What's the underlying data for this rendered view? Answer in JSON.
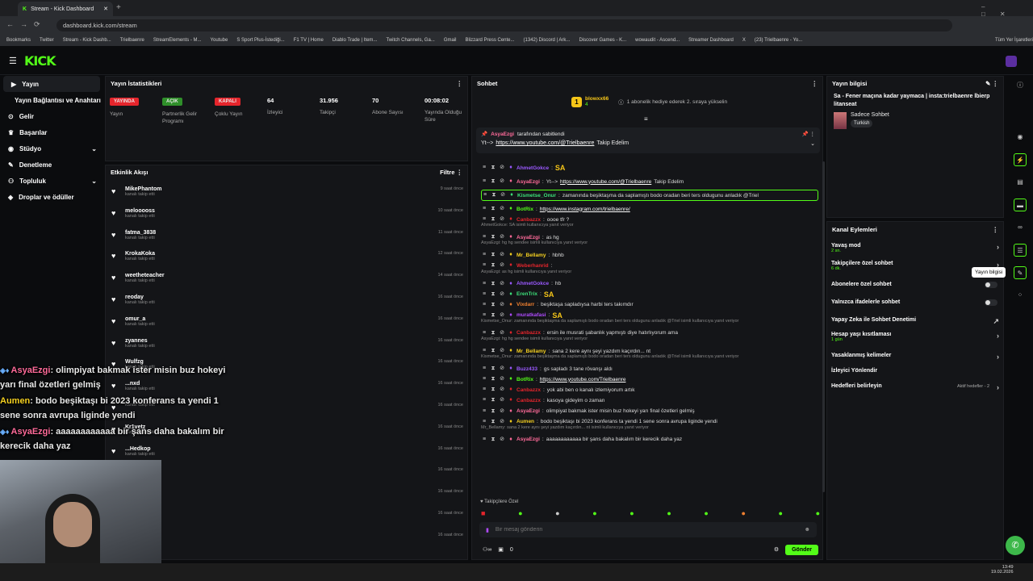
{
  "browser": {
    "tab_title": "Stream - Kick Dashboard",
    "url": "dashboard.kick.com/stream",
    "bookmarks": [
      "Bookmarks",
      "Twitter",
      "Stream - Kick Dashb...",
      "Trielbaenre",
      "StreamElements - M...",
      "Youtube",
      "S Sport Plus-İstediği...",
      "F1 TV | Home",
      "Diablo Trade | Item...",
      "Twitch Channels, Ga...",
      "Gmail",
      "Blizzard Press Cente...",
      "(1342) Discord | Ark...",
      "Discover Games - K...",
      "wowaudit - Ascend...",
      "Streamer Dashboard",
      "X",
      "(23) Trielbaenre - Yo...",
      "Tüm Yer İşaretleri"
    ]
  },
  "sidebar": {
    "items": [
      {
        "label": "Yayın"
      },
      {
        "label": "Yayın Bağlantısı ve Anahtarı"
      },
      {
        "label": "Gelir"
      },
      {
        "label": "Başarılar"
      },
      {
        "label": "Stüdyo"
      },
      {
        "label": "Denetleme"
      },
      {
        "label": "Topluluk"
      },
      {
        "label": "Droplar ve ödüller"
      }
    ]
  },
  "stats": {
    "title": "Yayın İstatistikleri",
    "items": [
      {
        "badge": "YAYINDA",
        "label": "Yayın",
        "color": "#e5252c"
      },
      {
        "badge": "AÇIK",
        "label": "Partnerlik Gelir Programı",
        "color": "#2f8f2a"
      },
      {
        "badge": "KAPALI",
        "label": "Çoklu Yayın",
        "color": "#e5252c"
      },
      {
        "value": "64",
        "label": "İzleyici"
      },
      {
        "value": "31.956",
        "label": "Takipçi"
      },
      {
        "value": "70",
        "label": "Abone Sayısı"
      },
      {
        "value": "00:08:02",
        "label": "Yayında Olduğu Süre"
      }
    ]
  },
  "activity": {
    "title": "Etkinlik Akışı",
    "filter": "Filtre",
    "action": "kanalı takip etti",
    "rows": [
      {
        "name": "MikePhantom",
        "time": "9 saat önce"
      },
      {
        "name": "melooooss",
        "time": "10 saat önce"
      },
      {
        "name": "fatma_3838",
        "time": "11 saat önce"
      },
      {
        "name": "KrokaKoka",
        "time": "12 saat önce"
      },
      {
        "name": "weetheteacher",
        "time": "14 saat önce"
      },
      {
        "name": "reoday",
        "time": "16 saat önce"
      },
      {
        "name": "omur_a",
        "time": "16 saat önce"
      },
      {
        "name": "zyannes",
        "time": "16 saat önce"
      },
      {
        "name": "Wulfzg",
        "time": "16 saat önce"
      },
      {
        "name": "...nxd",
        "time": "16 saat önce"
      },
      {
        "name": "",
        "time": "16 saat önce"
      },
      {
        "name": "Kr1vetz",
        "time": "16 saat önce"
      },
      {
        "name": "...Hedkop",
        "time": "16 saat önce"
      },
      {
        "name": "",
        "time": "16 saat önce"
      },
      {
        "name": "",
        "time": "16 saat önce"
      },
      {
        "name": "",
        "time": "16 saat önce"
      },
      {
        "name": "",
        "time": "16 saat önce"
      }
    ]
  },
  "chat": {
    "title": "Sohbet",
    "gift_user": "blowxx66",
    "gift_count": "4",
    "gift_text": "1 abonelik hediye ederek 2. sıraya yükselin",
    "pinned_by": "AsyaEzgi",
    "pinned_suffix": "tarafından sabitlendi",
    "pinned_text": "Yt-->",
    "pinned_link": "https://www.youtube.com/@Trielbaenre",
    "pinned_after": "Takip Edelim",
    "messages": [
      {
        "user": "AhmetGokce",
        "color": "#9b59ff",
        "text": "SA"
      },
      {
        "user": "AsyaEzgi",
        "color": "#ff6b9a",
        "text": "Yt-->",
        "link": "https://www.youtube.com/@Trielbaenre",
        "after": "Takip Edelim"
      },
      {
        "user": "Kismetse_Onur",
        "color": "#3de07a",
        "text": "zamanında beşiktaşma da saplamıştı bodo oradan beri ters oldugunu anladık @Triel"
      },
      {
        "user": "BotRix",
        "color": "#53fc18",
        "text": "",
        "link": "https://www.instagram.com/trielbaenre/"
      },
      {
        "user": "Canbazzx",
        "color": "#e5252c",
        "text": "oooe tfr ?"
      },
      {
        "reply": "AhmetGokce: SA isimli kullanıcıya yanıt veriyor"
      },
      {
        "user": "AsyaEzgi",
        "color": "#ff6b9a",
        "text": "as hg"
      },
      {
        "reply": "AsyaEzgi: hg hg sendee isimli kullanıcıya yanıt veriyor"
      },
      {
        "user": "Mr_Bellamy",
        "color": "#f5d020",
        "text": "hbhb"
      },
      {
        "user": "Weberhanrid",
        "color": "#e5252c",
        "text": ""
      },
      {
        "reply": "AsyaEzgi: as hg isimli kullanıcıya yanıt veriyor"
      },
      {
        "user": "AhmetGokce",
        "color": "#9b59ff",
        "text": "hb"
      },
      {
        "user": "ErenTrix",
        "color": "#3de07a",
        "text": "SA"
      },
      {
        "user": "Vixdarr",
        "color": "#f08030",
        "text": "beşiktaşa sapladıysa harbi ters takımdır"
      },
      {
        "user": "muratkafasi",
        "color": "#b04bff",
        "text": "SA"
      },
      {
        "reply": "Kismetse_Onur: zamanında beşiktaşma da saplamıştı bodo oradan beri ters oldugunu anladık @Triel isimli kullanıcıya yanıt veriyor"
      },
      {
        "user": "Canbazzx",
        "color": "#e5252c",
        "text": "ersin ile musrati şabanlık yapmıştı diye hatırlıyorum ama"
      },
      {
        "reply": "AsyaEzgi: hg hg sendee isimli kullanıcıya yanıt veriyor"
      },
      {
        "user": "Mr_Bellamy",
        "color": "#f5d020",
        "text": "sana 2 kere aynı şeyi yazdım kaçırdın... nt"
      },
      {
        "reply": "Kismetse_Onur: zamanında beşiktaşma da saplamıştı bodo oradan beri ters oldugunu anladık @Triel isimli kullanıcıya yanıt veriyor"
      },
      {
        "user": "Buzz433",
        "color": "#9b59ff",
        "text": "gs sapladı 3 tane rövanşı aldı"
      },
      {
        "user": "BotRix",
        "color": "#53fc18",
        "text": "",
        "link": "https://www.youtube.com/Trielbaenre"
      },
      {
        "user": "Canbazzx",
        "color": "#e5252c",
        "text": "yok abi ben o kanalı izlemiyorum artık"
      },
      {
        "user": "Canbazzx",
        "color": "#e5252c",
        "text": "kasoya gideyim o zaman"
      },
      {
        "user": "AsyaEzgi",
        "color": "#ff6b9a",
        "text": "olimpiyat bakmak ister misin buz hokeyi yarı final özetleri gelmiş"
      },
      {
        "user": "Aumen",
        "color": "#f5d020",
        "text": "bodo beşiktaşı bi 2023 konferans ta yendi 1 sene sonra avrupa liginde yendi"
      },
      {
        "reply": "Mr_Bellamy: sana 2 kere aynı şeyi yazdım kaçırdın... nt isimli kullanıcıya yanıt veriyor"
      },
      {
        "user": "AsyaEzgi",
        "color": "#ff6b9a",
        "text": "aaaaaaaaaaaa bir şans daha bakalım bir kerecik daha yaz"
      }
    ],
    "followers_only": "Takipçilere Özel",
    "input_placeholder": "Bir mesaj gönderin",
    "points": "0",
    "send_label": "Gönder"
  },
  "stream_info": {
    "title": "Yayın bilgisi",
    "stream_title": "Sa - Fener maçına kadar yaymaca | insta:trielbaenre lbierp litanseat",
    "category": "Sadece Sohbet",
    "tag": "Turkish"
  },
  "channel_actions": {
    "title": "Kanal Eylemleri",
    "tooltip": "Yayın bilgisi",
    "items": [
      {
        "label": "Yavaş mod",
        "sub": "2 sn."
      },
      {
        "label": "Takipçilere özel sohbet",
        "sub": "6 dk."
      },
      {
        "label": "Abonelere özel sohbet",
        "sub": ""
      },
      {
        "label": "Yalnızca ifadelerle sohbet",
        "sub": ""
      },
      {
        "label": "Yapay Zeka ile Sohbet Denetimi",
        "sub": ""
      },
      {
        "label": "Hesap yaşı kısıtlaması",
        "sub": "1 gün"
      },
      {
        "label": "Yasaklanmış kelimeler",
        "sub": ""
      },
      {
        "label": "İzleyici Yönlendir",
        "sub": ""
      },
      {
        "label": "Hedefleri belirleyin",
        "sub": "",
        "right": "Aktif hedefler - 2"
      }
    ]
  },
  "overlay": {
    "lines": [
      {
        "user": "AsyaEzgi",
        "text": ": olimpiyat bakmak ister misin buz hokeyi yarı final özetleri gelmiş"
      },
      {
        "user": "Aumen",
        "text": ": bodo beşiktaşı bi 2023 konferans ta yendi 1 sene sonra avrupa liginde yendi"
      },
      {
        "user": "AsyaEzgi",
        "text": ": aaaaaaaaaaaa bir şans daha bakalım bir kerecik daha yaz"
      }
    ]
  },
  "taskbar": {
    "time": "13:49",
    "date": "19.02.2026"
  }
}
